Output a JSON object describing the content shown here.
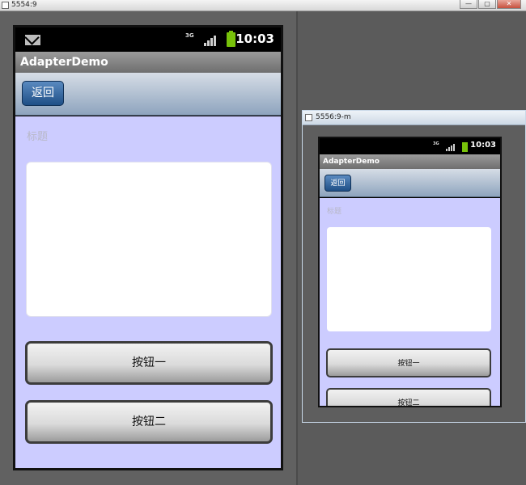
{
  "main_window": {
    "title": "5554:9",
    "controls": [
      "—",
      "▢",
      "✕"
    ]
  },
  "main_device": {
    "status_bar": {
      "network": "3G",
      "time": "10:03",
      "battery_color": "#78c20a"
    },
    "app_title": "AdapterDemo",
    "back_button": "返回",
    "title_label": "标题",
    "buttons": [
      "按钮一",
      "按钮二"
    ]
  },
  "second_window": {
    "title": "5556:9-m",
    "status_bar": {
      "network": "3G",
      "time": "10:03"
    },
    "app_title": "AdapterDemo",
    "back_button": "返回",
    "title_label": "标题",
    "buttons": [
      "按钮一",
      "按钮二"
    ]
  },
  "colors": {
    "content_background": "#ccccff",
    "nav_gradient_top": "#d6dde6",
    "back_button": "#1f4f86"
  }
}
